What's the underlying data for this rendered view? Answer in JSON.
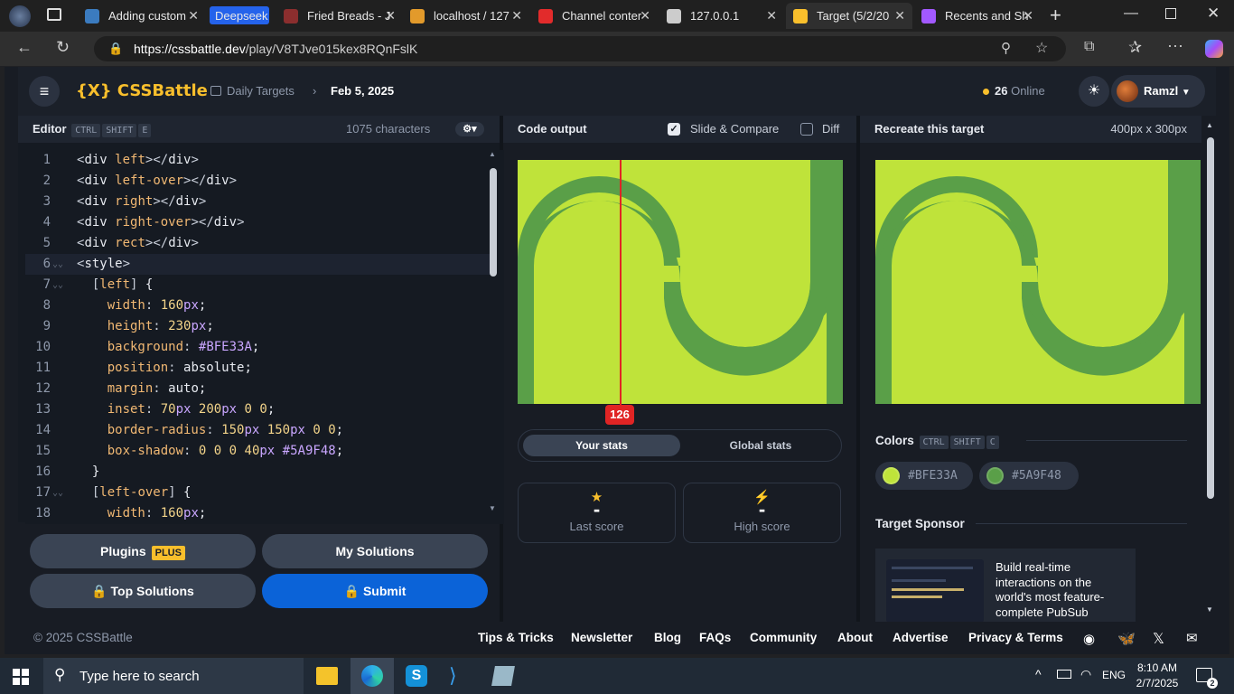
{
  "browser": {
    "tabs": [
      {
        "title": "Adding custom",
        "favicon": "#3b7bbf"
      },
      {
        "title": "Deepseek",
        "favicon": "#2563eb"
      },
      {
        "title": "Fried Breads - J",
        "favicon": "#8b2e2e"
      },
      {
        "title": "localhost / 127",
        "favicon": "#e29a2b"
      },
      {
        "title": "Channel conter",
        "favicon": "#e22b2b"
      },
      {
        "title": "127.0.0.1",
        "favicon": "#cccccc"
      },
      {
        "title": "Target (5/2/20",
        "favicon": "#f9bf2c"
      },
      {
        "title": "Recents and Sh",
        "favicon": "#a259ff"
      }
    ],
    "url_domain": "https://cssbattle.dev",
    "url_path": "/play/V8TJve015kex8RQnFslK"
  },
  "nav": {
    "logo": "{X} CSSBattle",
    "breadcrumb_parent": "Daily Targets",
    "breadcrumb_current": "Feb 5, 2025",
    "online_count": "26",
    "online_label": "Online",
    "user_name": "Ramzl"
  },
  "editor": {
    "title": "Editor",
    "shortcut": [
      "CTRL",
      "SHIFT",
      "E"
    ],
    "char_count": "1075 characters",
    "lines": [
      "<div left></div>",
      "<div left-over></div>",
      "<div right></div>",
      "<div right-over></div>",
      "<div rect></div>",
      "<style>",
      "  [left] {",
      "    width: 160px;",
      "    height: 230px;",
      "    background: #BFE33A;",
      "    position: absolute;",
      "    margin: auto;",
      "    inset: 70px 200px 0 0;",
      "    border-radius: 150px 150px 0 0;",
      "    box-shadow: 0 0 0 40px #5A9F48;",
      "  }",
      "  [left-over] {",
      "    width: 160px;"
    ],
    "line_numbers": [
      "1",
      "2",
      "3",
      "4",
      "5",
      "6",
      "7",
      "8",
      "9",
      "10",
      "11",
      "12",
      "13",
      "14",
      "15",
      "16",
      "17",
      "18"
    ]
  },
  "actions": {
    "plugins": "Plugins",
    "plus": "PLUS",
    "my_solutions": "My Solutions",
    "top_solutions": "Top Solutions",
    "submit": "Submit"
  },
  "output": {
    "title": "Code output",
    "slide_compare": "Slide & Compare",
    "diff": "Diff",
    "slider_value": "126",
    "your_stats": "Your stats",
    "global_stats": "Global stats",
    "last_score_value": "-",
    "last_score_label": "Last score",
    "high_score_value": "-",
    "high_score_label": "High score"
  },
  "target": {
    "title": "Recreate this target",
    "size": "400px x 300px",
    "colors_label": "Colors",
    "colors_shortcut": [
      "CTRL",
      "SHIFT",
      "C"
    ],
    "colors": [
      "#BFE33A",
      "#5A9F48"
    ],
    "sponsor_label": "Target Sponsor",
    "sponsor_text": "Build real-time interactions on the world's most feature-complete PubSub"
  },
  "footer": {
    "copyright": "© 2025 CSSBattle",
    "links": [
      "Tips & Tricks",
      "Newsletter",
      "Blog",
      "FAQs",
      "Community",
      "About",
      "Advertise",
      "Privacy & Terms"
    ]
  },
  "taskbar": {
    "search_placeholder": "Type here to search",
    "language": "ENG",
    "time": "8:10 AM",
    "date": "2/7/2025"
  }
}
